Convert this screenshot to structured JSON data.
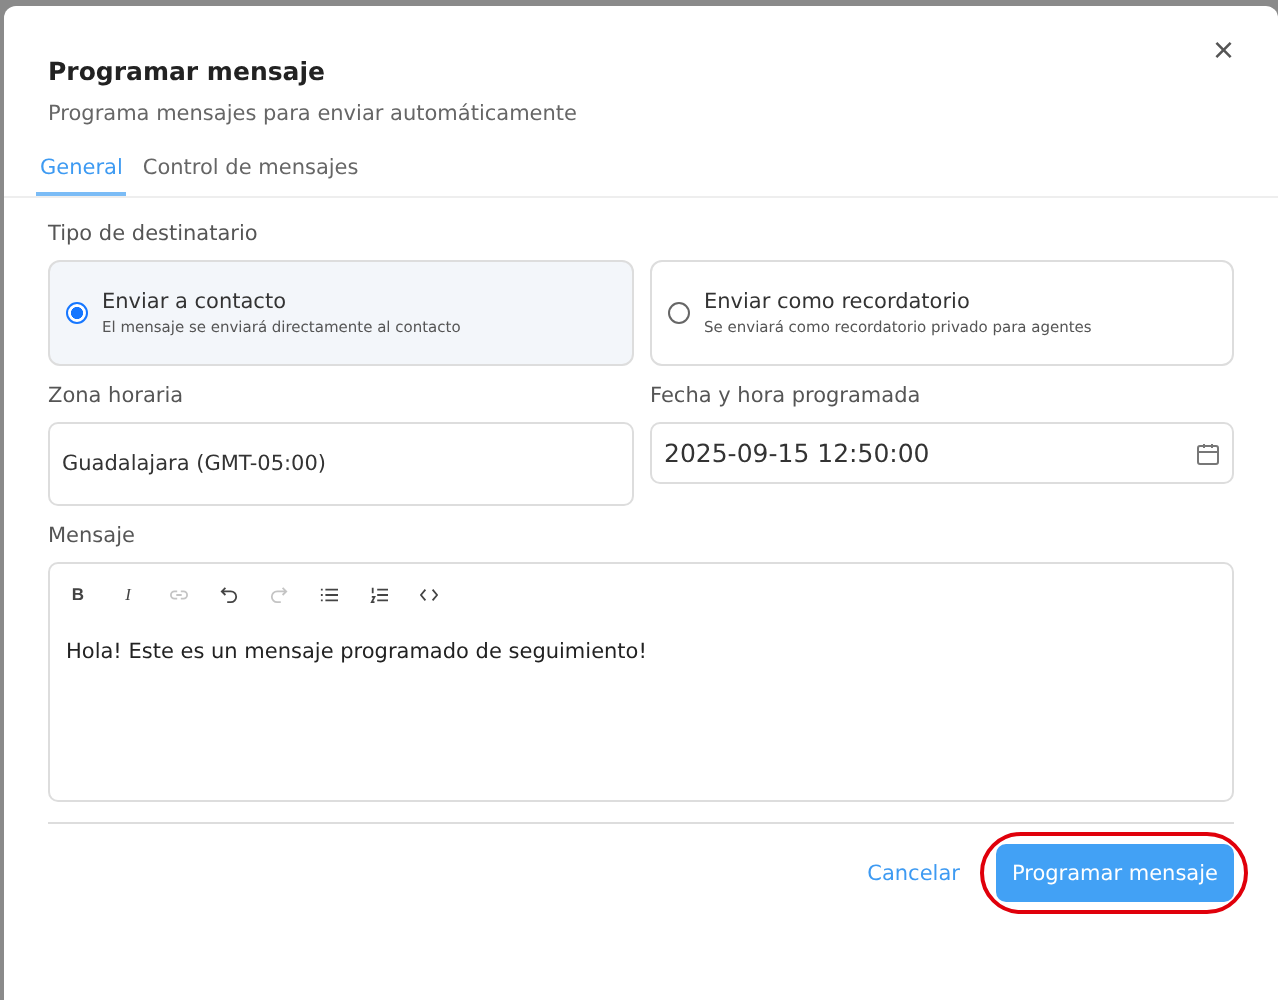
{
  "dialog": {
    "title": "Programar mensaje",
    "subtitle": "Programa mensajes para enviar automáticamente",
    "close": "×"
  },
  "tabs": [
    {
      "label": "General",
      "selected": true
    },
    {
      "label": "Control de mensajes",
      "selected": false
    }
  ],
  "recipient": {
    "label": "Tipo de destinatario",
    "options": [
      {
        "title": "Enviar a contacto",
        "description": "El mensaje se enviará directamente al contacto",
        "selected": true
      },
      {
        "title": "Enviar como recordatorio",
        "description": "Se enviará como recordatorio privado para agentes",
        "selected": false
      }
    ]
  },
  "timezone": {
    "label": "Zona horaria",
    "value": "Guadalajara (GMT-05:00)"
  },
  "datetime": {
    "label": "Fecha y hora programada",
    "value": "2025-09-15 12:50:00"
  },
  "message": {
    "label": "Mensaje",
    "toolbar": [
      {
        "kind": "bold",
        "label": "B",
        "disabled": false
      },
      {
        "kind": "italic",
        "label": "I",
        "disabled": false
      },
      {
        "kind": "link",
        "disabled": true
      },
      {
        "kind": "undo",
        "disabled": false
      },
      {
        "kind": "redo",
        "disabled": true
      },
      {
        "kind": "bullet-list",
        "disabled": false
      },
      {
        "kind": "numbered-list",
        "disabled": false
      },
      {
        "kind": "code",
        "disabled": false
      }
    ],
    "text": "Hola! Este es un mensaje programado de seguimiento!"
  },
  "footer": {
    "cancel": "Cancelar",
    "submit": "Programar mensaje",
    "submit_highlighted": true
  }
}
